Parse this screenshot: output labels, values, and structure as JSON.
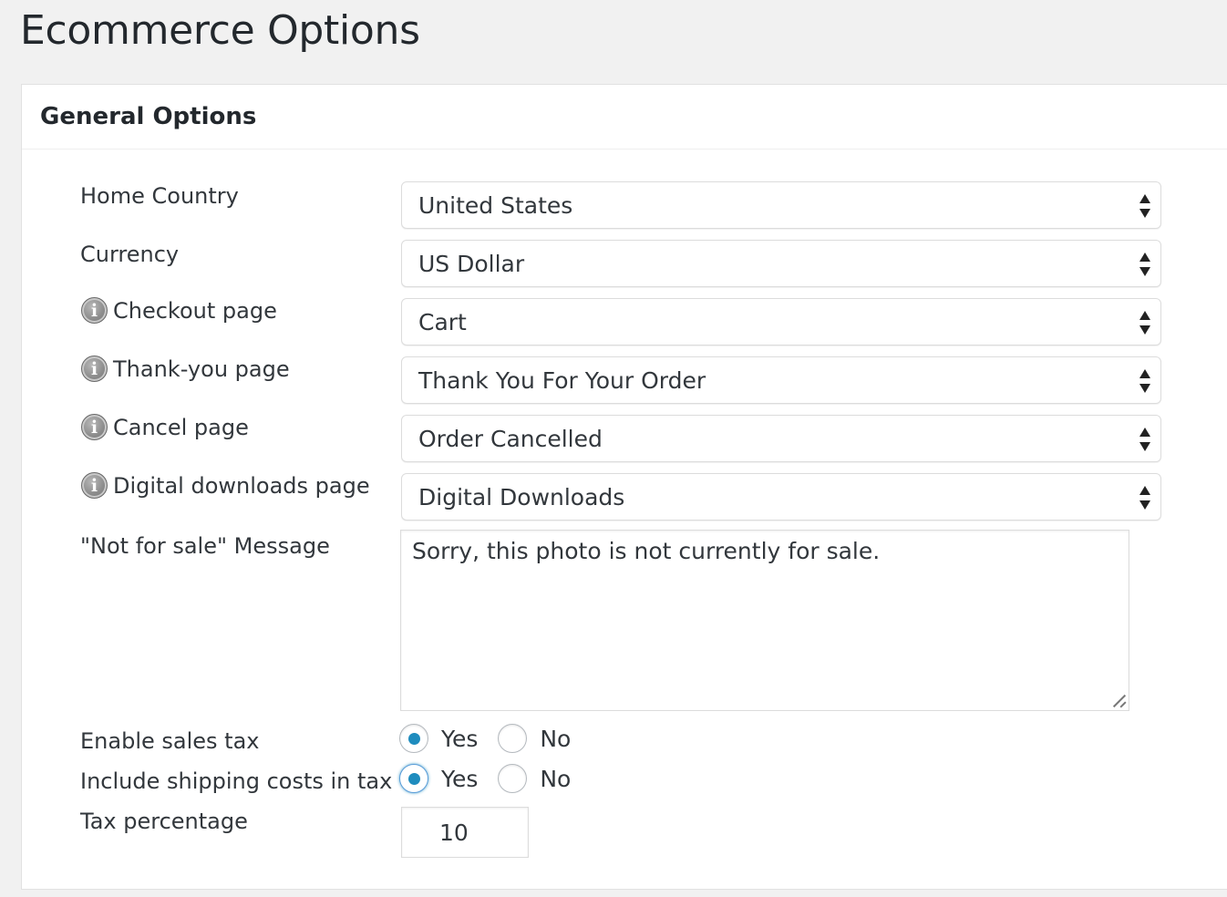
{
  "page": {
    "title": "Ecommerce Options"
  },
  "panel": {
    "title": "General Options"
  },
  "fields": {
    "home_country": {
      "label": "Home Country",
      "value": "United States"
    },
    "currency": {
      "label": "Currency",
      "value": "US Dollar"
    },
    "checkout_page": {
      "label": "Checkout page",
      "value": "Cart"
    },
    "thank_you_page": {
      "label": "Thank-you page",
      "value": "Thank You For Your Order"
    },
    "cancel_page": {
      "label": "Cancel page",
      "value": "Order Cancelled"
    },
    "digital_downloads_page": {
      "label": "Digital downloads page",
      "value": "Digital Downloads"
    },
    "not_for_sale": {
      "label": "\"Not for sale\" Message",
      "value": "Sorry, this photo is not currently for sale."
    },
    "enable_sales_tax": {
      "label": "Enable sales tax",
      "yes": "Yes",
      "no": "No",
      "selected": "Yes"
    },
    "include_shipping": {
      "label": "Include shipping costs in tax",
      "yes": "Yes",
      "no": "No",
      "selected": "Yes"
    },
    "tax_percentage": {
      "label": "Tax percentage",
      "value": "10"
    }
  },
  "icons": {
    "info": "info-icon",
    "info_glyph": "i"
  },
  "colors": {
    "accent": "#1e8cbe",
    "background": "#f1f1f1"
  }
}
